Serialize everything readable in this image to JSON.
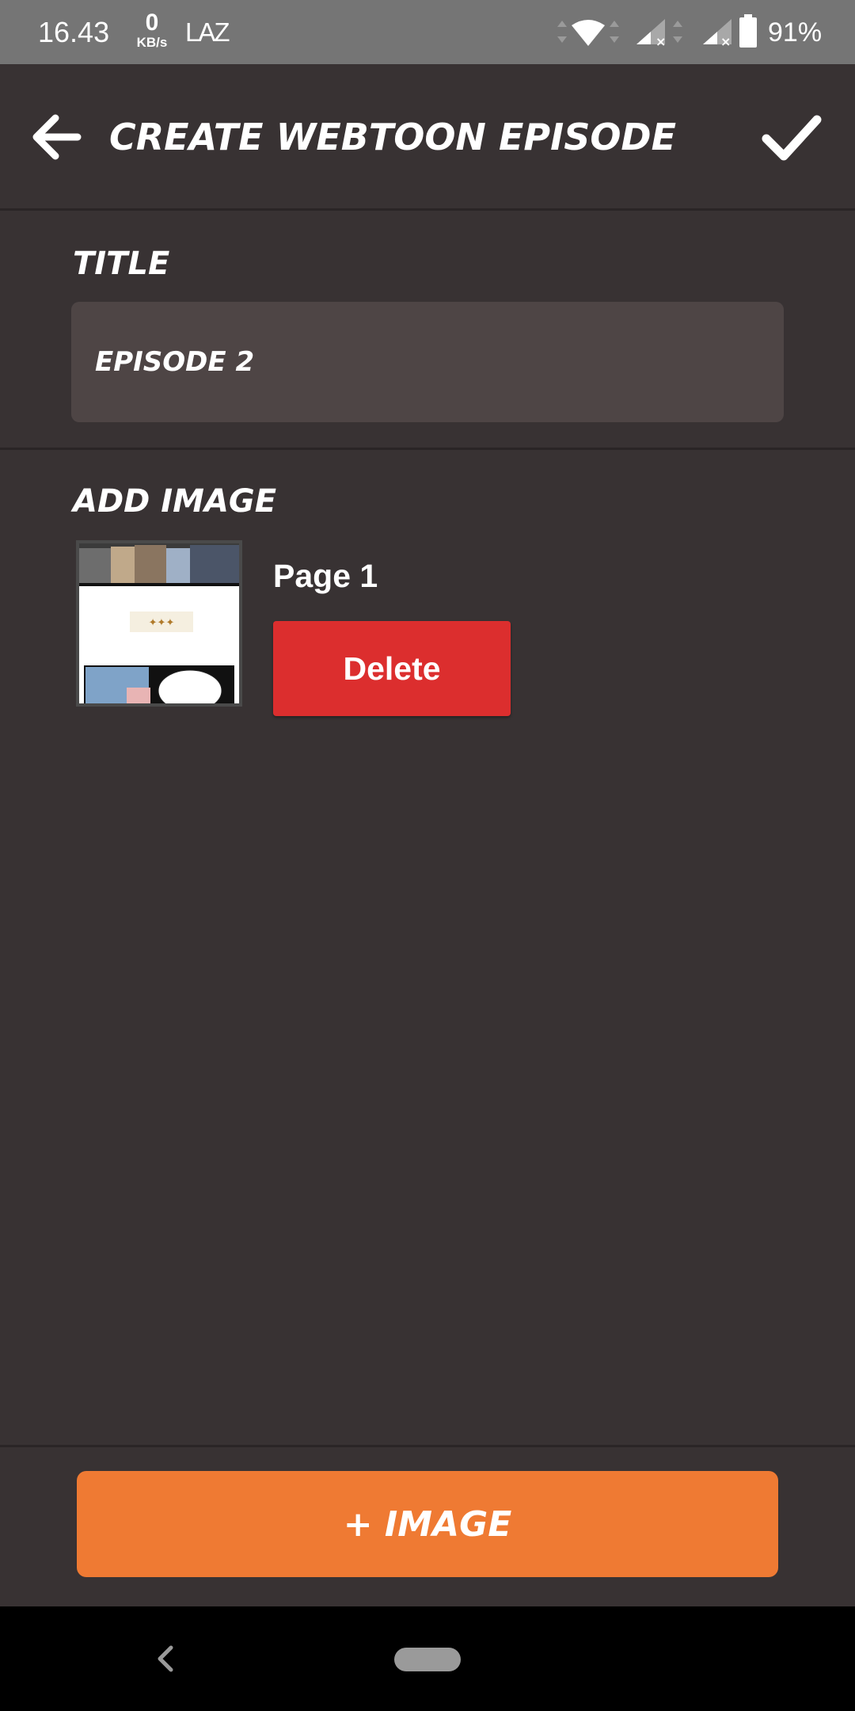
{
  "status_bar": {
    "time": "16.43",
    "speed_value": "0",
    "speed_unit": "KB/s",
    "carrier": "LAZ",
    "battery_percent": "91%",
    "icons": [
      "wifi-icon",
      "signal-icon",
      "signal-icon",
      "battery-icon"
    ]
  },
  "app_bar": {
    "title": "CREATE WEBTOON EPISODE",
    "back_icon": "arrow-left-icon",
    "confirm_icon": "check-icon"
  },
  "title_section": {
    "label": "TITLE",
    "value": "EPISODE 2"
  },
  "image_section": {
    "label": "ADD IMAGE",
    "items": [
      {
        "page_label": "Page 1",
        "delete_label": "Delete"
      }
    ]
  },
  "bottom": {
    "add_image_label": "+ IMAGE"
  },
  "colors": {
    "background": "#383233",
    "input_background": "#4e4545",
    "delete": "#dc2e2e",
    "accent": "#ef7a33",
    "status_bar": "#757575"
  }
}
